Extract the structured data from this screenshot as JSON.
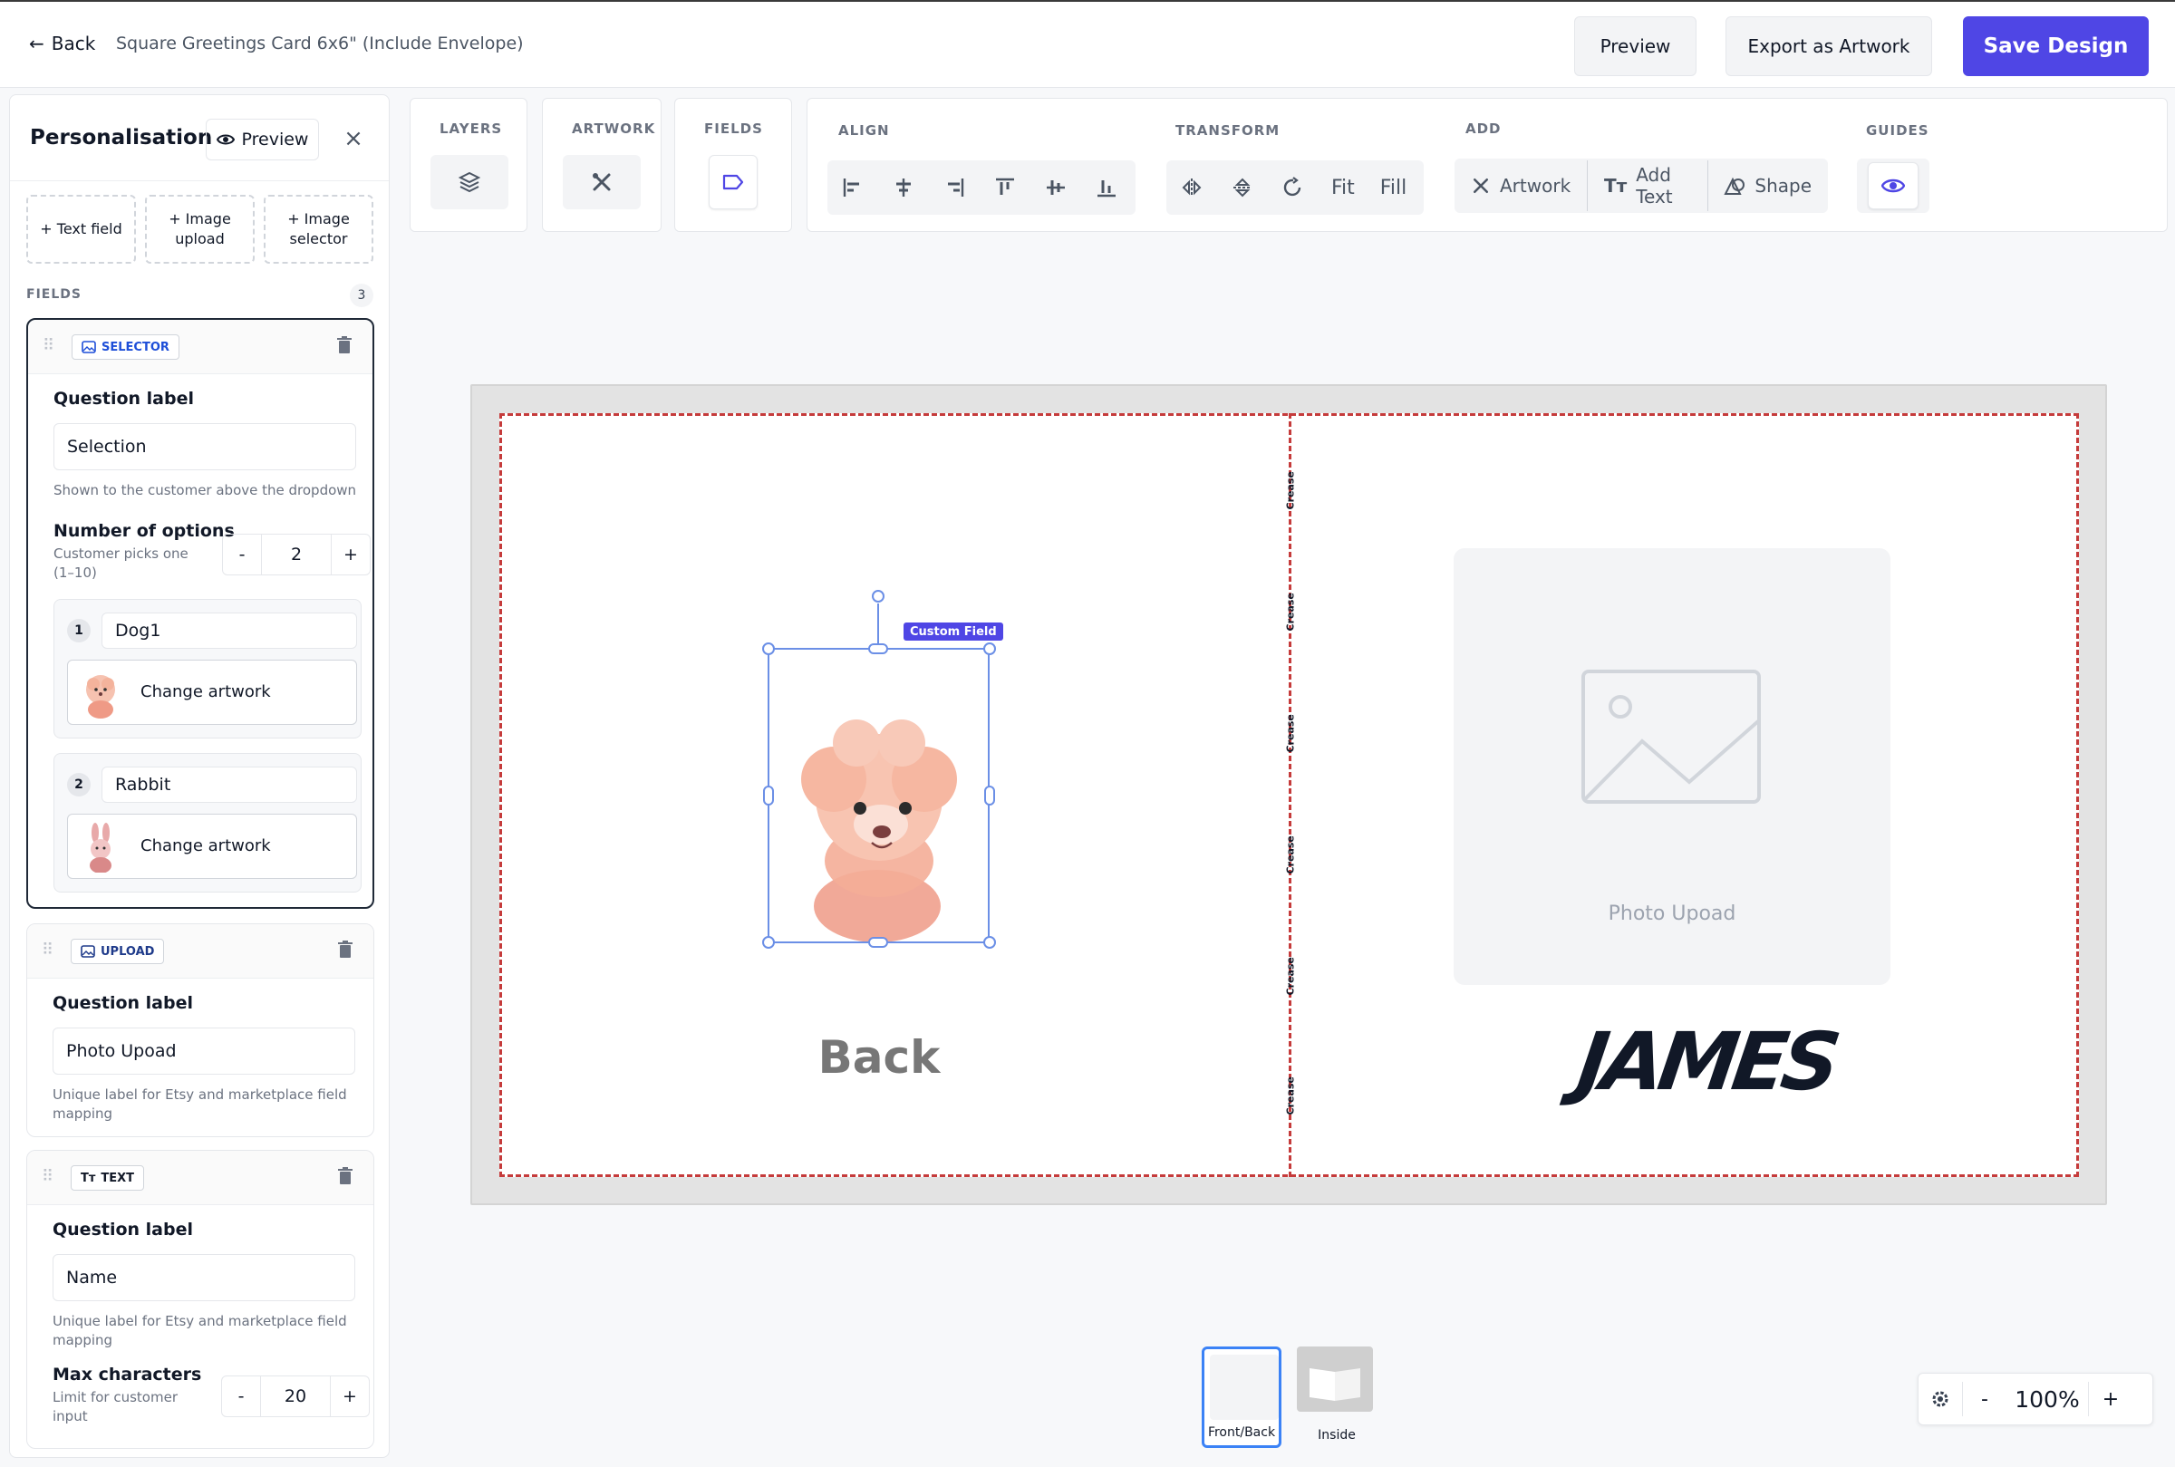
{
  "header": {
    "back_label": "Back",
    "product_title": "Square Greetings Card 6x6\" (Include Envelope)",
    "preview_label": "Preview",
    "export_label": "Export as Artwork",
    "save_label": "Save Design"
  },
  "panel": {
    "title": "Personalisation",
    "preview_label": "Preview",
    "add_buttons": [
      "+ Text field",
      "+ Image upload",
      "+ Image selector"
    ],
    "fields_label": "FIELDS",
    "fields_count": "3",
    "fields": [
      {
        "type": "SELECTOR",
        "question_label": "Question label",
        "question_value": "Selection",
        "hint": "Shown to the customer above the dropdown",
        "num_options_label": "Number of options",
        "num_options_hint": "Customer picks one (1–10)",
        "num_options_value": "2",
        "options": [
          {
            "num": "1",
            "name": "Dog1",
            "art_label": "Change artwork"
          },
          {
            "num": "2",
            "name": "Rabbit",
            "art_label": "Change artwork"
          }
        ]
      },
      {
        "type": "UPLOAD",
        "question_label": "Question label",
        "question_value": "Photo Upoad",
        "hint": "Unique label for Etsy and marketplace field mapping"
      },
      {
        "type": "TEXT",
        "question_label": "Question label",
        "question_value": "Name",
        "hint": "Unique label for Etsy and marketplace field mapping",
        "max_label": "Max characters",
        "max_hint": "Limit for customer input",
        "max_value": "20"
      }
    ]
  },
  "toolbar": {
    "layers_label": "LAYERS",
    "artwork_label": "ARTWORK",
    "fields_label": "FIELDS",
    "align_label": "ALIGN",
    "transform_label": "TRANSFORM",
    "fit_label": "Fit",
    "fill_label": "Fill",
    "add_label": "ADD",
    "add_artwork": "Artwork",
    "add_text": "Add Text",
    "add_shape": "Shape",
    "guides_label": "GUIDES"
  },
  "canvas": {
    "crease_label": "Crease",
    "back_text": "Back",
    "photo_label": "Photo Upoad",
    "name_text": "JAMES",
    "custom_field_tag": "Custom Field"
  },
  "pages": {
    "front_back": "Front/Back",
    "inside": "Inside"
  },
  "zoom": {
    "value": "100%",
    "minus": "-",
    "plus": "+"
  },
  "colors": {
    "accent": "#4f46e5",
    "guide": "#c53b3b",
    "selection": "#6b8fe6"
  }
}
